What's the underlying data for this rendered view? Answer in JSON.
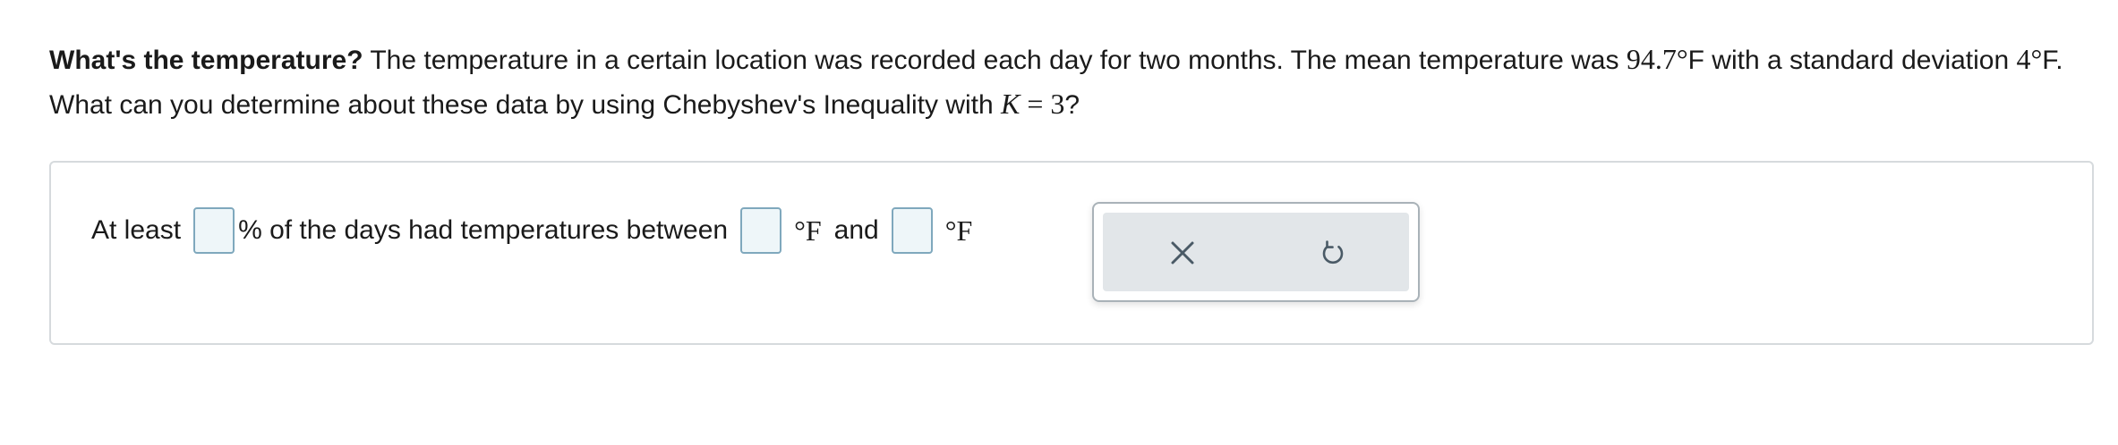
{
  "question": {
    "lead": "What's the temperature?",
    "text_1": " The temperature in a certain location was recorded each day for two months. The mean temperature was ",
    "mean_value": "94.7°",
    "text_2": "F with a standard deviation ",
    "sd_value": "4°",
    "text_3": "F. What can you determine about these data by using Chebyshev's Inequality with ",
    "k_var": "K",
    "k_eq": " = 3",
    "text_4": "?"
  },
  "answer": {
    "prefix": "At least",
    "percent_label": "% of the days had temperatures between",
    "unit_1": "°F",
    "and_label": "and",
    "unit_2": "°F",
    "blank_percent_value": "",
    "blank_low_value": "",
    "blank_high_value": ""
  },
  "tools": {
    "clear_icon": "close-icon",
    "reset_icon": "undo-icon"
  },
  "colors": {
    "blank_border": "#7fa8bd",
    "blank_fill": "#eef6f9",
    "tool_bg": "#e2e6e9",
    "icon": "#4a5a66"
  }
}
